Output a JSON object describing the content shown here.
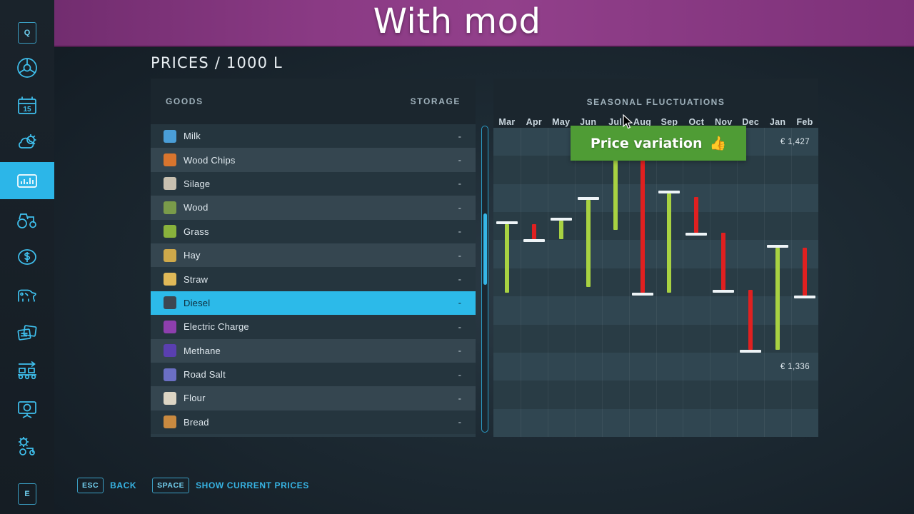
{
  "banner": {
    "title": "With mod"
  },
  "rail": {
    "items": [
      {
        "name": "key-q-indicator",
        "icon": "key-q-icon",
        "label": "Q",
        "active": false
      },
      {
        "name": "sidebar-item-vehicle",
        "icon": "steering-wheel-icon",
        "label": "",
        "active": false
      },
      {
        "name": "sidebar-item-calendar",
        "icon": "calendar-icon",
        "label": "15",
        "active": false
      },
      {
        "name": "sidebar-item-weather",
        "icon": "weather-icon",
        "label": "",
        "active": false
      },
      {
        "name": "sidebar-item-prices",
        "icon": "bar-chart-icon",
        "label": "",
        "active": true
      },
      {
        "name": "sidebar-item-vehicles",
        "icon": "tractor-icon",
        "label": "",
        "active": false
      },
      {
        "name": "sidebar-item-finances",
        "icon": "dollar-coin-icon",
        "label": "",
        "active": false
      },
      {
        "name": "sidebar-item-animals",
        "icon": "cow-icon",
        "label": "",
        "active": false
      },
      {
        "name": "sidebar-item-contracts",
        "icon": "documents-icon",
        "label": "",
        "active": false
      },
      {
        "name": "sidebar-item-production",
        "icon": "conveyor-icon",
        "label": "",
        "active": false
      },
      {
        "name": "sidebar-item-help",
        "icon": "presentation-help-icon",
        "label": "",
        "active": false
      },
      {
        "name": "sidebar-item-settings",
        "icon": "tractor-gear-icon",
        "label": "",
        "active": false
      },
      {
        "name": "key-e-indicator",
        "icon": "key-e-icon",
        "label": "E",
        "active": false
      }
    ]
  },
  "page": {
    "title": "PRICES / 1000 L"
  },
  "goods_table": {
    "headers": {
      "goods": "GOODS",
      "storage": "STORAGE"
    },
    "rows": [
      {
        "label": "Milk",
        "storage": "-",
        "icon": "milk-bottle-icon",
        "color": "#4a9ed8",
        "selected": false
      },
      {
        "label": "Wood Chips",
        "storage": "-",
        "icon": "wood-chips-icon",
        "color": "#d9752e",
        "selected": false
      },
      {
        "label": "Silage",
        "storage": "-",
        "icon": "silage-icon",
        "color": "#c8c0b0",
        "selected": false
      },
      {
        "label": "Wood",
        "storage": "-",
        "icon": "wood-log-icon",
        "color": "#7a9b4a",
        "selected": false
      },
      {
        "label": "Grass",
        "storage": "-",
        "icon": "grass-icon",
        "color": "#89b23c",
        "selected": false
      },
      {
        "label": "Hay",
        "storage": "-",
        "icon": "hay-icon",
        "color": "#cfa94a",
        "selected": false
      },
      {
        "label": "Straw",
        "storage": "-",
        "icon": "straw-icon",
        "color": "#e0b958",
        "selected": false
      },
      {
        "label": "Diesel",
        "storage": "-",
        "icon": "diesel-canister-icon",
        "color": "#3d4650",
        "selected": true
      },
      {
        "label": "Electric Charge",
        "storage": "-",
        "icon": "battery-icon",
        "color": "#8e3fae",
        "selected": false
      },
      {
        "label": "Methane",
        "storage": "-",
        "icon": "methane-icon",
        "color": "#5a3fb0",
        "selected": false
      },
      {
        "label": "Road Salt",
        "storage": "-",
        "icon": "road-salt-icon",
        "color": "#6b6fc4",
        "selected": false
      },
      {
        "label": "Flour",
        "storage": "-",
        "icon": "flour-bag-icon",
        "color": "#ddd5c4",
        "selected": false
      },
      {
        "label": "Bread",
        "storage": "-",
        "icon": "bread-icon",
        "color": "#c98a40",
        "selected": false
      }
    ]
  },
  "tooltip": {
    "text": "Price variation",
    "emoji": "👍"
  },
  "hints": [
    {
      "key": "ESC",
      "label": "BACK"
    },
    {
      "key": "SPACE",
      "label": "SHOW CURRENT PRICES"
    }
  ],
  "chart_data": {
    "type": "bar",
    "title": "SEASONAL FLUCTUATIONS",
    "xlabel": "",
    "ylabel": "",
    "grid": true,
    "legend": "none",
    "price_labels": {
      "high": "€ 1,427",
      "low": "€ 1,336"
    },
    "ylim": [
      1336,
      1427
    ],
    "categories": [
      "Mar",
      "Apr",
      "May",
      "Jun",
      "Jul",
      "Aug",
      "Sep",
      "Oct",
      "Nov",
      "Dec",
      "Jan",
      "Feb"
    ],
    "series": [
      {
        "name": "Price variation",
        "bars": [
          {
            "month": "Mar",
            "direction": "up",
            "start": 1377,
            "end": 1400,
            "cap": "top"
          },
          {
            "month": "Apr",
            "direction": "down",
            "start": 1400,
            "end": 1395,
            "cap": "bottom"
          },
          {
            "month": "May",
            "direction": "up",
            "start": 1395,
            "end": 1401,
            "cap": "top"
          },
          {
            "month": "Jun",
            "direction": "up",
            "start": 1379,
            "end": 1408,
            "cap": "top"
          },
          {
            "month": "Jul",
            "direction": "up",
            "start": 1398,
            "end": 1425,
            "cap": "top"
          },
          {
            "month": "Aug",
            "direction": "down",
            "start": 1424,
            "end": 1377,
            "cap": "bottom"
          },
          {
            "month": "Sep",
            "direction": "up",
            "start": 1377,
            "end": 1410,
            "cap": "top"
          },
          {
            "month": "Oct",
            "direction": "down",
            "start": 1409,
            "end": 1397,
            "cap": "bottom"
          },
          {
            "month": "Nov",
            "direction": "down",
            "start": 1397,
            "end": 1378,
            "cap": "bottom"
          },
          {
            "month": "Dec",
            "direction": "down",
            "start": 1378,
            "end": 1358,
            "cap": "bottom"
          },
          {
            "month": "Jan",
            "direction": "up",
            "start": 1358,
            "end": 1392,
            "cap": "top"
          },
          {
            "month": "Feb",
            "direction": "down",
            "start": 1392,
            "end": 1376,
            "cap": "bottom"
          }
        ]
      }
    ],
    "colors": {
      "up": "#a8d242",
      "down": "#e02020",
      "cap": "#eef4f7",
      "plot_bg": "#304651"
    }
  }
}
